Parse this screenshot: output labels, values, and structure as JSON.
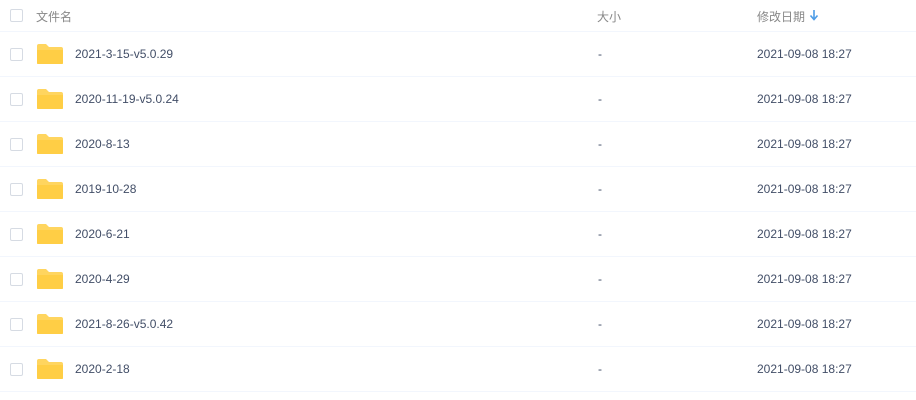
{
  "header": {
    "name": "文件名",
    "size": "大小",
    "modified": "修改日期",
    "sort_icon": "arrow-down-icon"
  },
  "colors": {
    "folder": "#ffd55f",
    "sort_arrow": "#4d9ce6"
  },
  "files": [
    {
      "name": "2021-3-15-v5.0.29",
      "size": "-",
      "modified": "2021-09-08 18:27",
      "icon": "folder-icon"
    },
    {
      "name": "2020-11-19-v5.0.24",
      "size": "-",
      "modified": "2021-09-08 18:27",
      "icon": "folder-icon"
    },
    {
      "name": "2020-8-13",
      "size": "-",
      "modified": "2021-09-08 18:27",
      "icon": "folder-icon"
    },
    {
      "name": "2019-10-28",
      "size": "-",
      "modified": "2021-09-08 18:27",
      "icon": "folder-icon"
    },
    {
      "name": "2020-6-21",
      "size": "-",
      "modified": "2021-09-08 18:27",
      "icon": "folder-icon"
    },
    {
      "name": "2020-4-29",
      "size": "-",
      "modified": "2021-09-08 18:27",
      "icon": "folder-icon"
    },
    {
      "name": "2021-8-26-v5.0.42",
      "size": "-",
      "modified": "2021-09-08 18:27",
      "icon": "folder-icon"
    },
    {
      "name": "2020-2-18",
      "size": "-",
      "modified": "2021-09-08 18:27",
      "icon": "folder-icon"
    }
  ]
}
